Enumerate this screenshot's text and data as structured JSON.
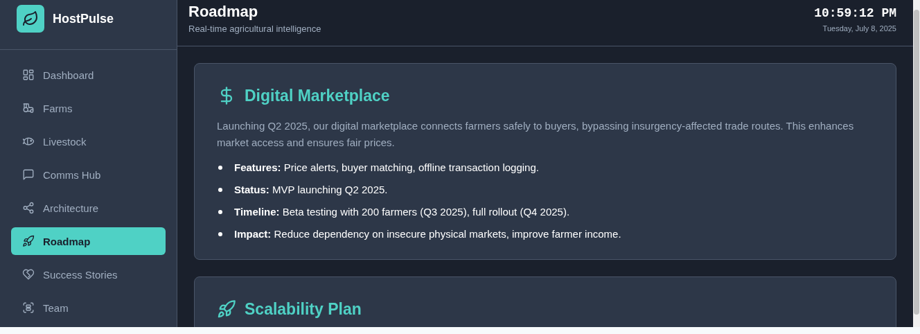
{
  "brand": {
    "name": "HostPulse"
  },
  "nav": [
    {
      "label": "Dashboard",
      "selected": false
    },
    {
      "label": "Farms",
      "selected": false
    },
    {
      "label": "Livestock",
      "selected": false
    },
    {
      "label": "Comms Hub",
      "selected": false
    },
    {
      "label": "Architecture",
      "selected": false
    },
    {
      "label": "Roadmap",
      "selected": true
    },
    {
      "label": "Success Stories",
      "selected": false
    },
    {
      "label": "Team",
      "selected": false
    }
  ],
  "header": {
    "title": "Roadmap",
    "subtitle": "Real-time agricultural intelligence",
    "time": "10:59:12 PM",
    "date": "Tuesday, July 8, 2025"
  },
  "cards": [
    {
      "title": "Digital Marketplace",
      "description": "Launching Q2 2025, our digital marketplace connects farmers safely to buyers, bypassing insurgency-affected trade routes. This enhances market access and ensures fair prices.",
      "points": [
        "**Features:** Price alerts, buyer matching, offline transaction logging.",
        "**Status:** MVP launching Q2 2025.",
        "**Timeline:** Beta testing with 200 farmers (Q3 2025), full rollout (Q4 2025).",
        "**Impact:** Reduce dependency on insecure physical markets, improve farmer income."
      ]
    },
    {
      "title": "Scalability Plan"
    }
  ]
}
